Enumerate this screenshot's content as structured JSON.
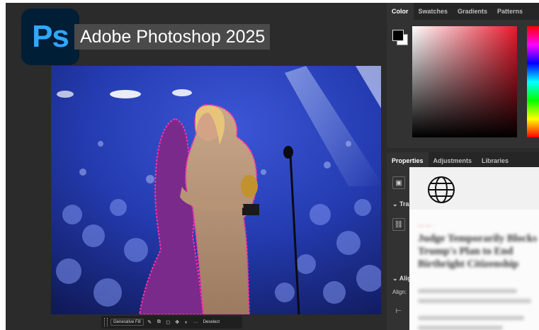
{
  "app": {
    "logo_text": "Ps",
    "title": "Adobe Photoshop 2025",
    "brand_color": "#31a8ff"
  },
  "color_panel": {
    "tabs": [
      "Color",
      "Swatches",
      "Gradients",
      "Patterns"
    ],
    "active_tab": "Color",
    "foreground_color": "#000000",
    "background_color": "#ffffff"
  },
  "properties_panel": {
    "tabs": [
      "Properties",
      "Adjustments",
      "Libraries"
    ],
    "active_tab": "Properties",
    "transform_label": "Tra",
    "align_label": "Alig",
    "align_sub": "Align:"
  },
  "taskbar": {
    "generative_fill": "Generative Fill",
    "more": "···",
    "deselect": "Deselect"
  },
  "overlay": {
    "icon": "globe-icon",
    "kicker": "— — ·",
    "headline": "Judge Temporarily Blocks Trump's Plan to End Birthright Citizenship"
  },
  "selection_color": "#ff2fa8"
}
